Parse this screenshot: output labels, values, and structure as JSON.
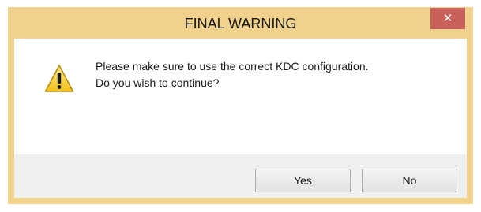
{
  "window": {
    "title": "FINAL WARNING",
    "close_glyph": "✕",
    "frame_color": "#f0d28c",
    "close_color": "#c9605a"
  },
  "message": {
    "icon": "warning-icon",
    "line1": "Please make sure to use the correct KDC configuration.",
    "line2": "Do you wish to continue?"
  },
  "buttons": {
    "yes_label": "Yes",
    "no_label": "No"
  }
}
